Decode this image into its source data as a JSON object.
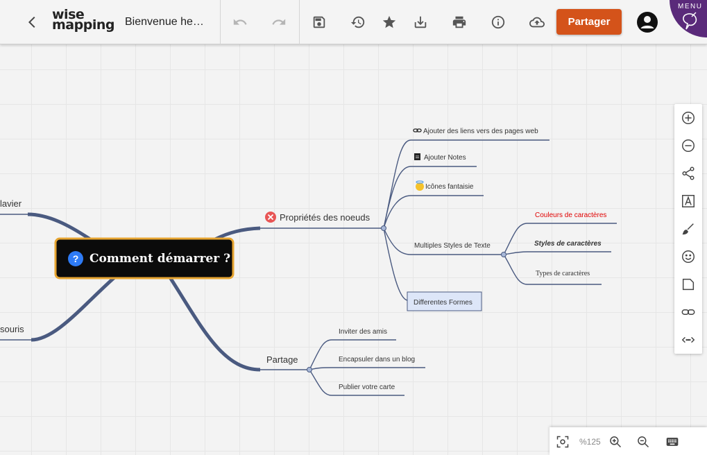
{
  "header": {
    "back_icon": "arrow-back-icon",
    "logo_line1": "wise",
    "logo_line2": "mapping",
    "doc_title": "Bienvenue he…",
    "toolbar_icons": [
      "undo-icon",
      "redo-icon",
      "save-icon",
      "history-icon",
      "star-icon",
      "download-icon",
      "print-icon",
      "info-icon",
      "cloud-upload-icon"
    ],
    "share_label": "Partager",
    "avatar_icon": "account-icon",
    "menu_label": "MENU"
  },
  "colors": {
    "accent": "#d4531a",
    "central_bg": "#0b0b0b",
    "central_border": "#e7a531",
    "branch": "#4a5a80",
    "red_text": "#e00000",
    "shape_fill": "#dde6f8"
  },
  "mindmap": {
    "central": "Comment démarrer ?",
    "left_nodes": [
      "lavier",
      "souris"
    ],
    "proprietes": "Propriétés des noeuds",
    "prop_children": [
      "Ajouter des liens vers des pages web",
      "Ajouter Notes",
      "Icônes fantaisie",
      "Multiples Styles de Texte",
      "Differentes Formes"
    ],
    "styles_children": [
      "Couleurs de caractères",
      "Styles de caractères",
      "Types de caractères"
    ],
    "partage": "Partage",
    "partage_children": [
      "Inviter des amis",
      "Encapsuler dans un blog",
      "Publier votre carte"
    ]
  },
  "right_tools": [
    "zoom-in-circle-icon",
    "zoom-out-circle-icon",
    "share-icon",
    "text-format-icon",
    "brush-icon",
    "emoji-icon",
    "note-icon",
    "link-icon",
    "code-icon"
  ],
  "zoom": {
    "label": "%125",
    "icons": [
      "fit-screen-icon",
      "zoom-in-icon",
      "zoom-out-icon",
      "keyboard-icon"
    ]
  }
}
